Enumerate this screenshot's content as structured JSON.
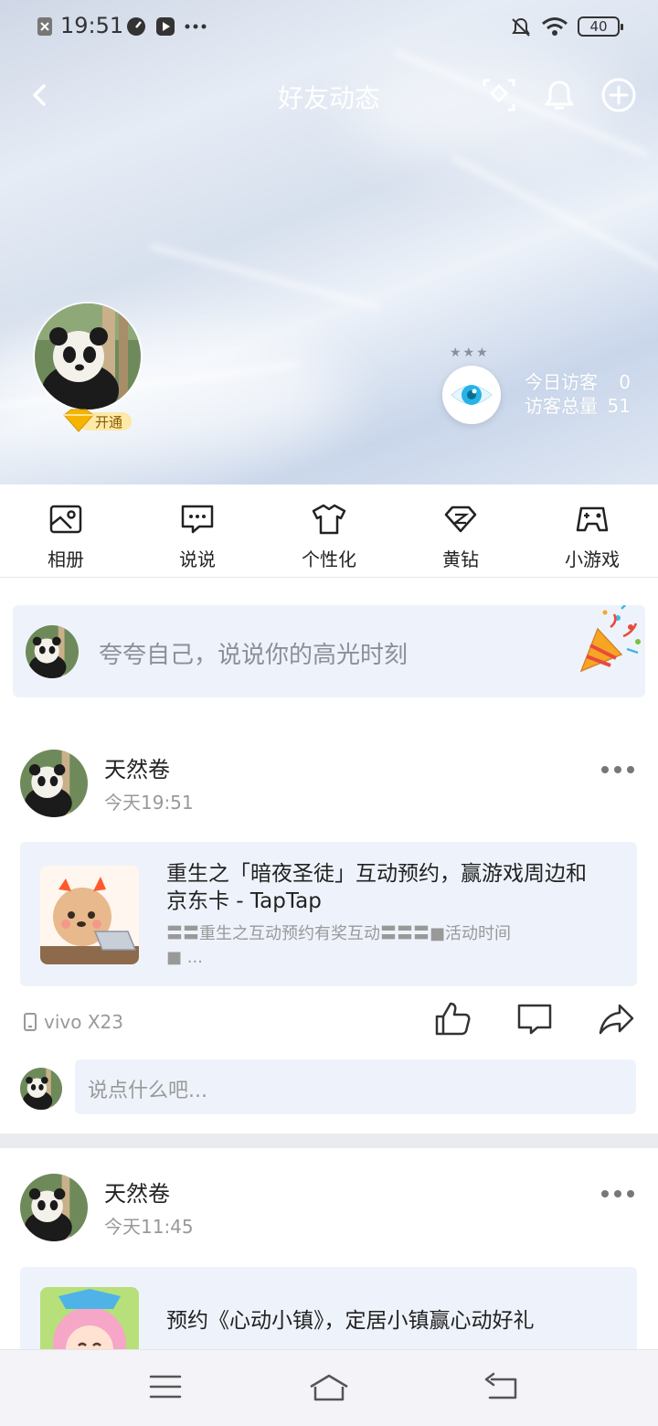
{
  "status_bar": {
    "time": "19:51",
    "battery": "40"
  },
  "nav": {
    "title": "好友动态"
  },
  "profile": {
    "vip_label": "开通"
  },
  "visitors": {
    "today_label": "今日访客",
    "today_value": "0",
    "total_label": "访客总量",
    "total_value": "51"
  },
  "menu": {
    "items": [
      {
        "label": "相册",
        "icon": "album-icon"
      },
      {
        "label": "说说",
        "icon": "chat-bubble-icon"
      },
      {
        "label": "个性化",
        "icon": "tshirt-icon"
      },
      {
        "label": "黄钻",
        "icon": "diamond-icon"
      },
      {
        "label": "小游戏",
        "icon": "gamepad-icon"
      }
    ]
  },
  "composer": {
    "placeholder": "夸夸自己，说说你的高光时刻"
  },
  "posts": [
    {
      "author": "天然卷",
      "time": "今天19:51",
      "card_title": "重生之「暗夜圣徒」互动预约，赢游戏周边和京东卡 - TapTap",
      "card_desc": "〓〓重生之互动预约有奖互动〓〓〓■活动时间■  ...",
      "device": "vivo X23",
      "comment_placeholder": "说点什么吧..."
    },
    {
      "author": "天然卷",
      "time": "今天11:45",
      "card_title": "预约《心动小镇》，定居小镇赢心动好礼"
    }
  ],
  "colors": {
    "accent": "#27b3e6",
    "card_bg": "#eef3fb",
    "muted": "#999999"
  }
}
